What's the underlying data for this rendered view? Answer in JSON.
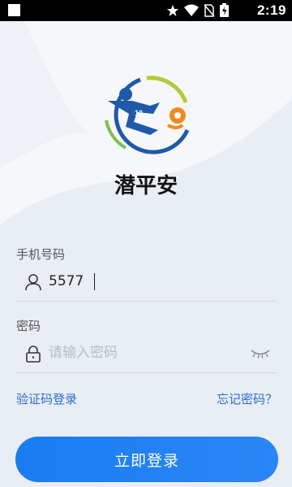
{
  "status_bar": {
    "time": "2:19"
  },
  "app": {
    "name": "潜平安",
    "logo_number": "10"
  },
  "phone": {
    "label": "手机号码",
    "value": "5577",
    "placeholder": ""
  },
  "password": {
    "label": "密码",
    "value": "",
    "placeholder": "请输入密码"
  },
  "links": {
    "sms_login": "验证码登录",
    "forgot_password": "忘记密码？"
  },
  "login_button": {
    "label": "立即登录"
  },
  "colors": {
    "accent": "#1a7cf2",
    "link": "#2b6fd6",
    "background": "#e9edf4"
  }
}
